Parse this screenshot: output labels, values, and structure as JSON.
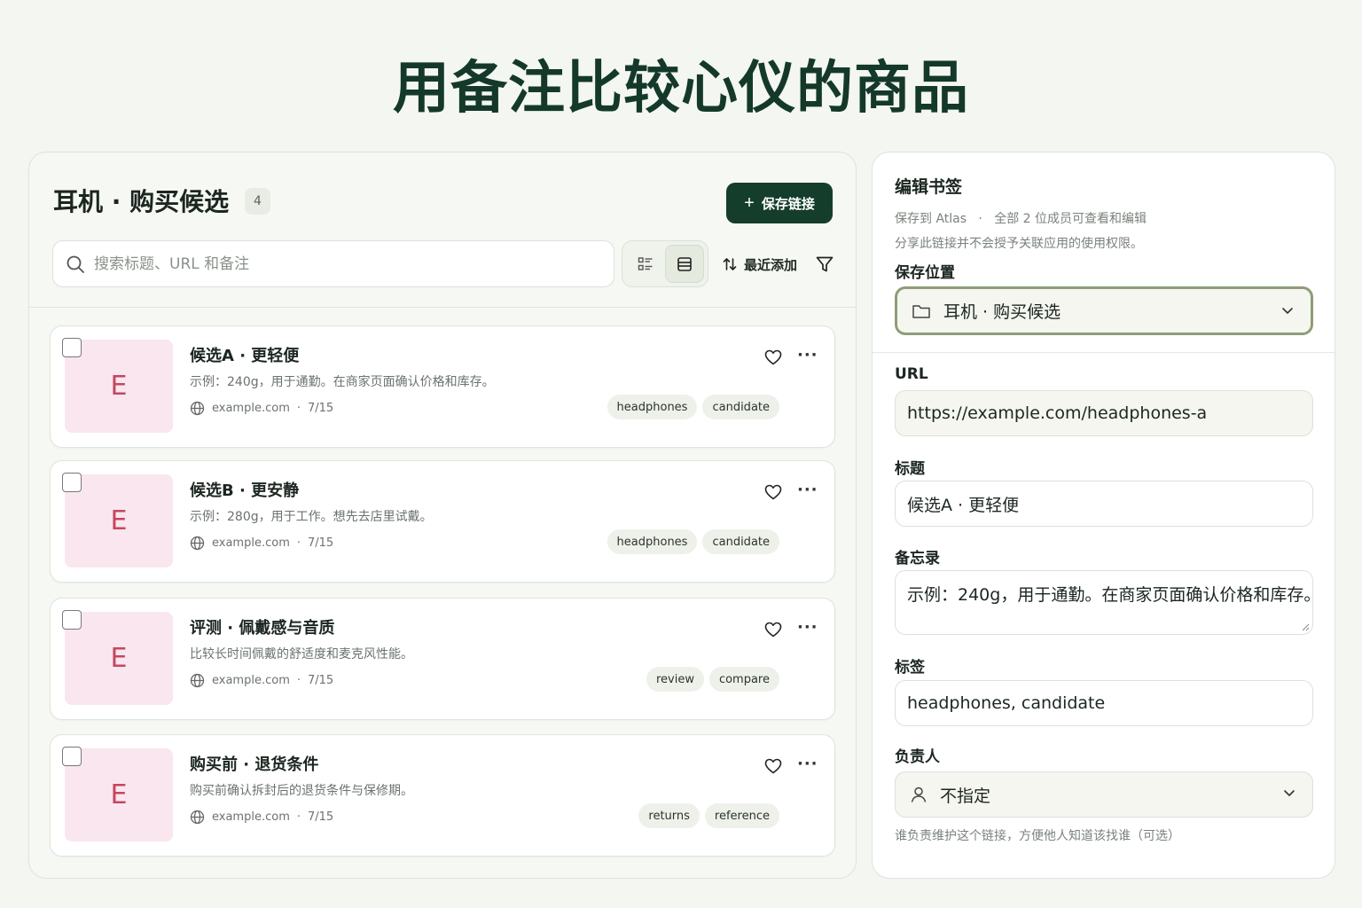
{
  "page_title": "用备注比较心仪的商品",
  "collection": {
    "title": "耳机 · 购买候选",
    "count": "4",
    "save_link_label": "保存链接",
    "search_placeholder": "搜索标题、URL 和备注",
    "sort_label": "最近添加"
  },
  "bookmarks": [
    {
      "thumb_letter": "E",
      "title": "候选A · 更轻便",
      "note": "示例：240g，用于通勤。在商家页面确认价格和库存。",
      "domain": "example.com",
      "date": "7/15",
      "tags": [
        "headphones",
        "candidate"
      ]
    },
    {
      "thumb_letter": "E",
      "title": "候选B · 更安静",
      "note": "示例：280g，用于工作。想先去店里试戴。",
      "domain": "example.com",
      "date": "7/15",
      "tags": [
        "headphones",
        "candidate"
      ]
    },
    {
      "thumb_letter": "E",
      "title": "评测 · 佩戴感与音质",
      "note": "比较长时间佩戴的舒适度和麦克风性能。",
      "domain": "example.com",
      "date": "7/15",
      "tags": [
        "review",
        "compare"
      ]
    },
    {
      "thumb_letter": "E",
      "title": "购买前 · 退货条件",
      "note": "购买前确认拆封后的退货条件与保修期。",
      "domain": "example.com",
      "date": "7/15",
      "tags": [
        "returns",
        "reference"
      ]
    }
  ],
  "editor": {
    "title": "编辑书签",
    "saved_to": "保存到 Atlas",
    "members_note": "全部 2 位成员可查看和编辑",
    "share_note": "分享此链接并不会授予关联应用的使用权限。",
    "location_label": "保存位置",
    "location_value": "耳机 · 购买候选",
    "url_label": "URL",
    "url_value": "https://example.com/headphones-a",
    "title_label": "标题",
    "title_value": "候选A · 更轻便",
    "memo_label": "备忘录",
    "memo_value": "示例：240g，用于通勤。在商家页面确认价格和库存。",
    "tags_label": "标签",
    "tags_value": "headphones, candidate",
    "owner_label": "负责人",
    "owner_value": "不指定",
    "owner_hint": "谁负责维护这个链接，方便他人知道该找谁（可选）"
  },
  "colors": {
    "primary": "#153d2c",
    "thumb_bg": "#f9e6ef",
    "thumb_letter": "#c4475f",
    "focus_border": "#8e9d78"
  }
}
